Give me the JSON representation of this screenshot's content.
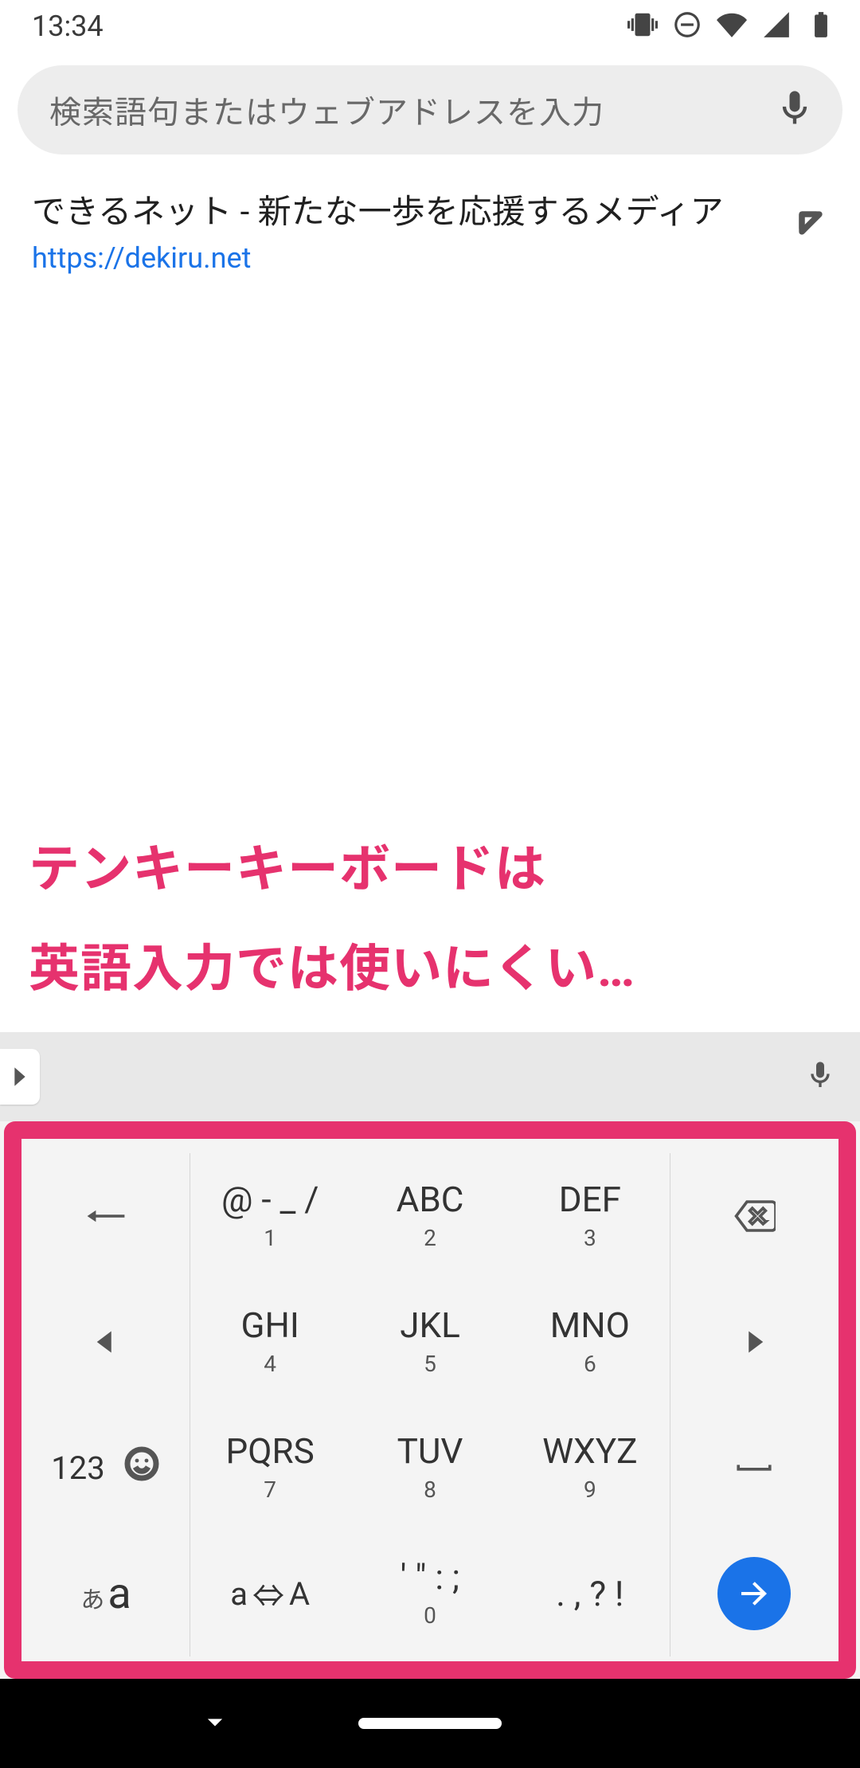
{
  "status": {
    "time": "13:34"
  },
  "search": {
    "placeholder": "検索語句またはウェブアドレスを入力"
  },
  "suggestion": {
    "title": "できるネット - 新たな一歩を応援するメディア",
    "url": "https://dekiru.net"
  },
  "annotation": {
    "line1": "テンキーキーボードは",
    "line2": "英語入力では使いにくい…"
  },
  "keyboard": {
    "row1": {
      "k1": "@ - _ /",
      "s1": "1",
      "k2": "ABC",
      "s2": "2",
      "k3": "DEF",
      "s3": "3"
    },
    "row2": {
      "k1": "GHI",
      "s1": "4",
      "k2": "JKL",
      "s2": "5",
      "k3": "MNO",
      "s3": "6"
    },
    "row3": {
      "numLabel": "123",
      "k1": "PQRS",
      "s1": "7",
      "k2": "TUV",
      "s2": "8",
      "k3": "WXYZ",
      "s3": "9"
    },
    "row4": {
      "langSmall": "あ",
      "langBig": "a",
      "caseA": "a",
      "caseB": "A",
      "k2": "' \" : ;",
      "s2": "0",
      "k3": ". , ? !"
    }
  }
}
